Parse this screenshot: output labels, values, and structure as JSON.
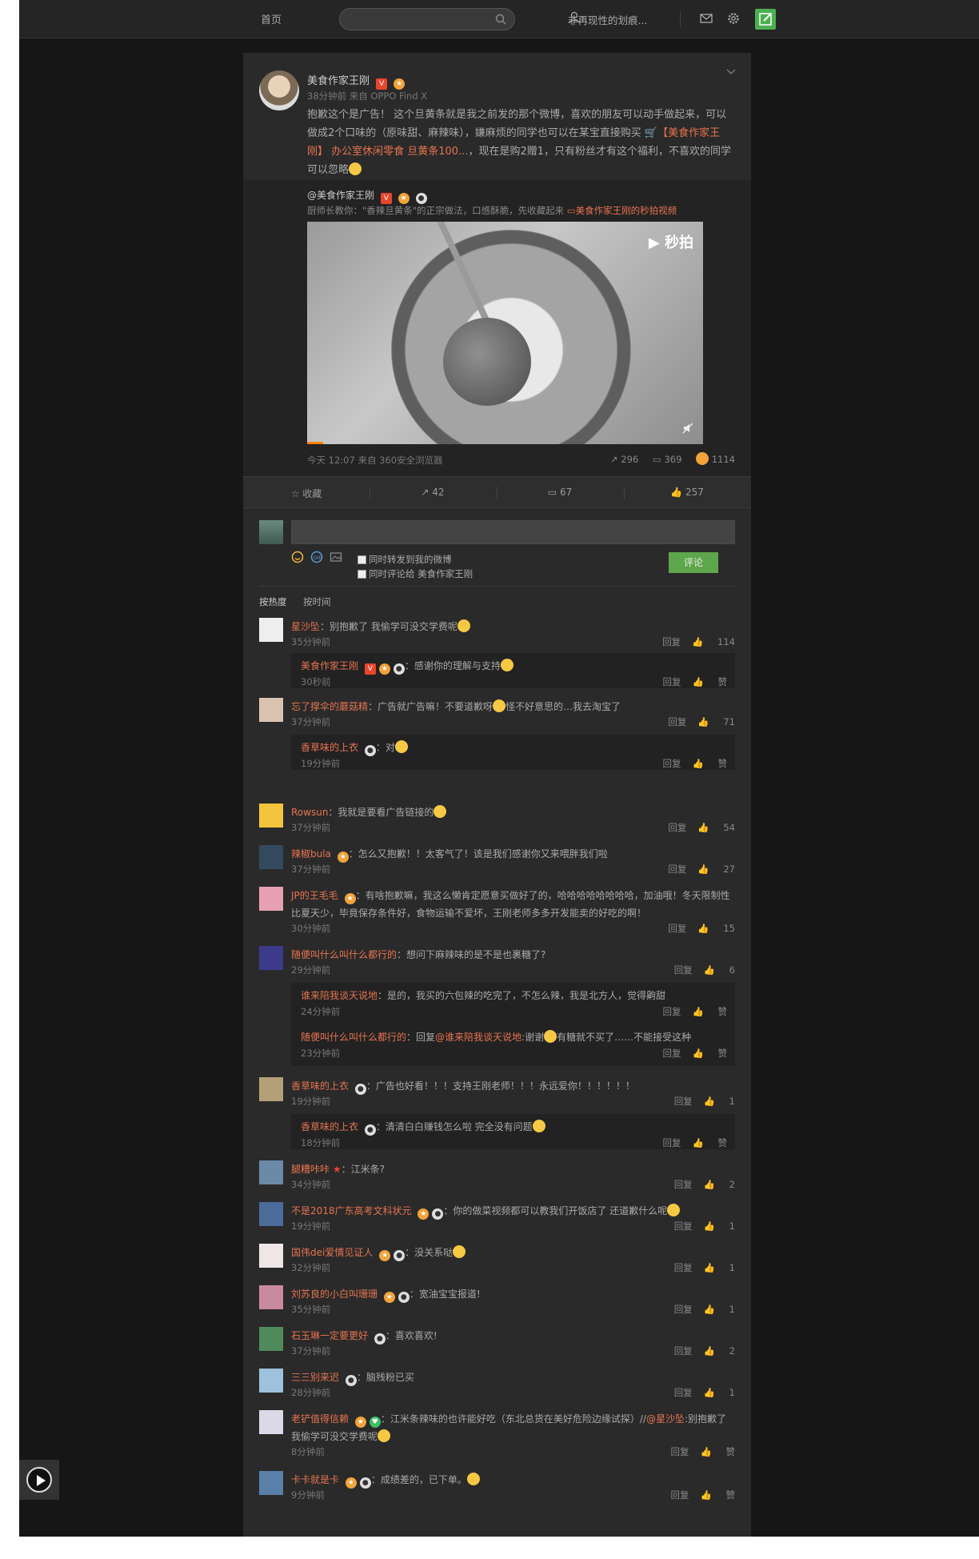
{
  "topbar": {
    "home": "首页",
    "search_placeholder": "",
    "username": "非再现性的划痕..."
  },
  "post": {
    "author": "美食作家王刚",
    "meta": "38分钟前 来自 OPPO Find X",
    "text_1": "抱歉这个是广告！ 这个旦黄条就是我之前发的那个微博，喜欢的朋友可以动手做起来，可以做成2个口味的（原味甜、麻辣味），嫌麻烦的同学也可以在某宝直接购买 ",
    "link": "【美食作家王刚】 办公室休闲零食 旦黄条100...",
    "text_2": "，现在是购2赠1，只有粉丝才有这个福利，不喜欢的同学可以忽略",
    "repost": {
      "author": "@美食作家王刚",
      "desc": "厨师长教你：\"香辣旦黄条\"的正宗做法，口感酥脆，先收藏起来 ",
      "video_link": "美食作家王刚的秒拍视频",
      "watermark": "秒拍",
      "footer": "今天 12:07 来自 360安全浏览器",
      "reposts": "296",
      "comments": "369",
      "likes": "1114"
    },
    "actions": {
      "fav": "收藏",
      "repost": "42",
      "comment": "67",
      "like": "257"
    }
  },
  "comment_box": {
    "check_1": "同时转发到我的微博",
    "check_2": "同时评论给 美食作家王刚",
    "submit": "评论"
  },
  "sort": {
    "hot": "按热度",
    "time": "按时间"
  },
  "comments": [
    {
      "name": "星沙坠",
      "text": "：别抱歉了 我偷学可没交学费呢",
      "time": "35分钟前",
      "reply": "回复",
      "likes": "114"
    },
    {
      "name": "美食作家王刚",
      "text": "：感谢你的理解与支持",
      "time": "30秒前",
      "reply": "回复",
      "likes": "赞"
    },
    {
      "name": "忘了撑伞的蘑菇精",
      "text": "：广告就广告嘛！不要道歉呀",
      "text2": "怪不好意思的…我去淘宝了",
      "time": "37分钟前",
      "reply": "回复",
      "likes": "71"
    },
    {
      "name": "香草味的上衣",
      "text": "：对",
      "time": "19分钟前",
      "reply": "回复",
      "likes": "赞"
    },
    {
      "name": "Rowsun",
      "text": "：我就是要看广告链接的",
      "time": "37分钟前",
      "reply": "回复",
      "likes": "54"
    },
    {
      "name": "辣椒bula",
      "text": "：怎么又抱歉！！太客气了！该是我们感谢你又来喂胖我们啦",
      "time": "37分钟前",
      "reply": "回复",
      "likes": "27"
    },
    {
      "name": "JP的王毛毛",
      "text": "：有啥抱歉嘛，我这么懒肯定愿意买做好了的，哈哈哈哈哈哈哈哈，加油哦！冬天限制性比夏天少，毕竟保存条件好，食物运输不爱坏，王刚老师多多开发能卖的好吃的啊！",
      "time": "30分钟前",
      "reply": "回复",
      "likes": "15"
    },
    {
      "name": "随便叫什么叫什么都行的",
      "text": "：想问下麻辣味的是不是也裹糖了?",
      "time": "29分钟前",
      "reply": "回复",
      "likes": "6"
    },
    {
      "name": "谁来陪我谈天说地",
      "text": "：是的，我买的六包辣的吃完了，不怎么辣，我是北方人，觉得齁甜",
      "time": "24分钟前",
      "reply": "回复",
      "likes": "赞"
    },
    {
      "name": "随便叫什么叫什么都行的",
      "text": "：回复",
      "at": "@谁来陪我谈天说地",
      "text2": ":谢谢",
      "text3": "有糖就不买了……不能接受这种",
      "time": "23分钟前",
      "reply": "回复",
      "likes": "赞"
    },
    {
      "name": "香草味的上衣",
      "text": "：广告也好看！！！支持王刚老师！！！永远爱你！！！！！！",
      "time": "19分钟前",
      "reply": "回复",
      "likes": "1"
    },
    {
      "name": "香草味的上衣",
      "text": "：清清白白赚钱怎么啦 完全没有问题",
      "time": "18分钟前",
      "reply": "回复",
      "likes": "赞"
    },
    {
      "name": "腿糟咔咔",
      "text": "：江米条?",
      "time": "34分钟前",
      "reply": "回复",
      "likes": "2"
    },
    {
      "name": "不是2018广东高考文科状元",
      "text": "：你的做菜视频都可以教我们开饭店了 还道歉什么呢",
      "time": "19分钟前",
      "reply": "回复",
      "likes": "1"
    },
    {
      "name": "国伟dei爱情见证人",
      "text": "：没关系哒",
      "time": "32分钟前",
      "reply": "回复",
      "likes": "1"
    },
    {
      "name": "刘苏良的小白叫珊珊",
      "text": "：宽油宝宝报道!",
      "time": "35分钟前",
      "reply": "回复",
      "likes": "1"
    },
    {
      "name": "石玉琳一定要更好",
      "text": "：喜欢喜欢!",
      "time": "37分钟前",
      "reply": "回复",
      "likes": "2"
    },
    {
      "name": "三三别来迟",
      "text": "：脑残粉已买",
      "time": "28分钟前",
      "reply": "回复",
      "likes": "1"
    },
    {
      "name": "老铲值得信赖",
      "text": "：江米条辣味的也许能好吃（东北总货在美好危险边缘试探）//",
      "at": "@星沙坠",
      "text2": ":别抱歉了 我偷学可没交学费呢",
      "time": "8分钟前",
      "reply": "回复",
      "likes": "赞"
    },
    {
      "name": "卡卡就是卡",
      "text": "：成绩差的，已下单。",
      "time": "9分钟前",
      "reply": "回复",
      "likes": "赞"
    }
  ]
}
